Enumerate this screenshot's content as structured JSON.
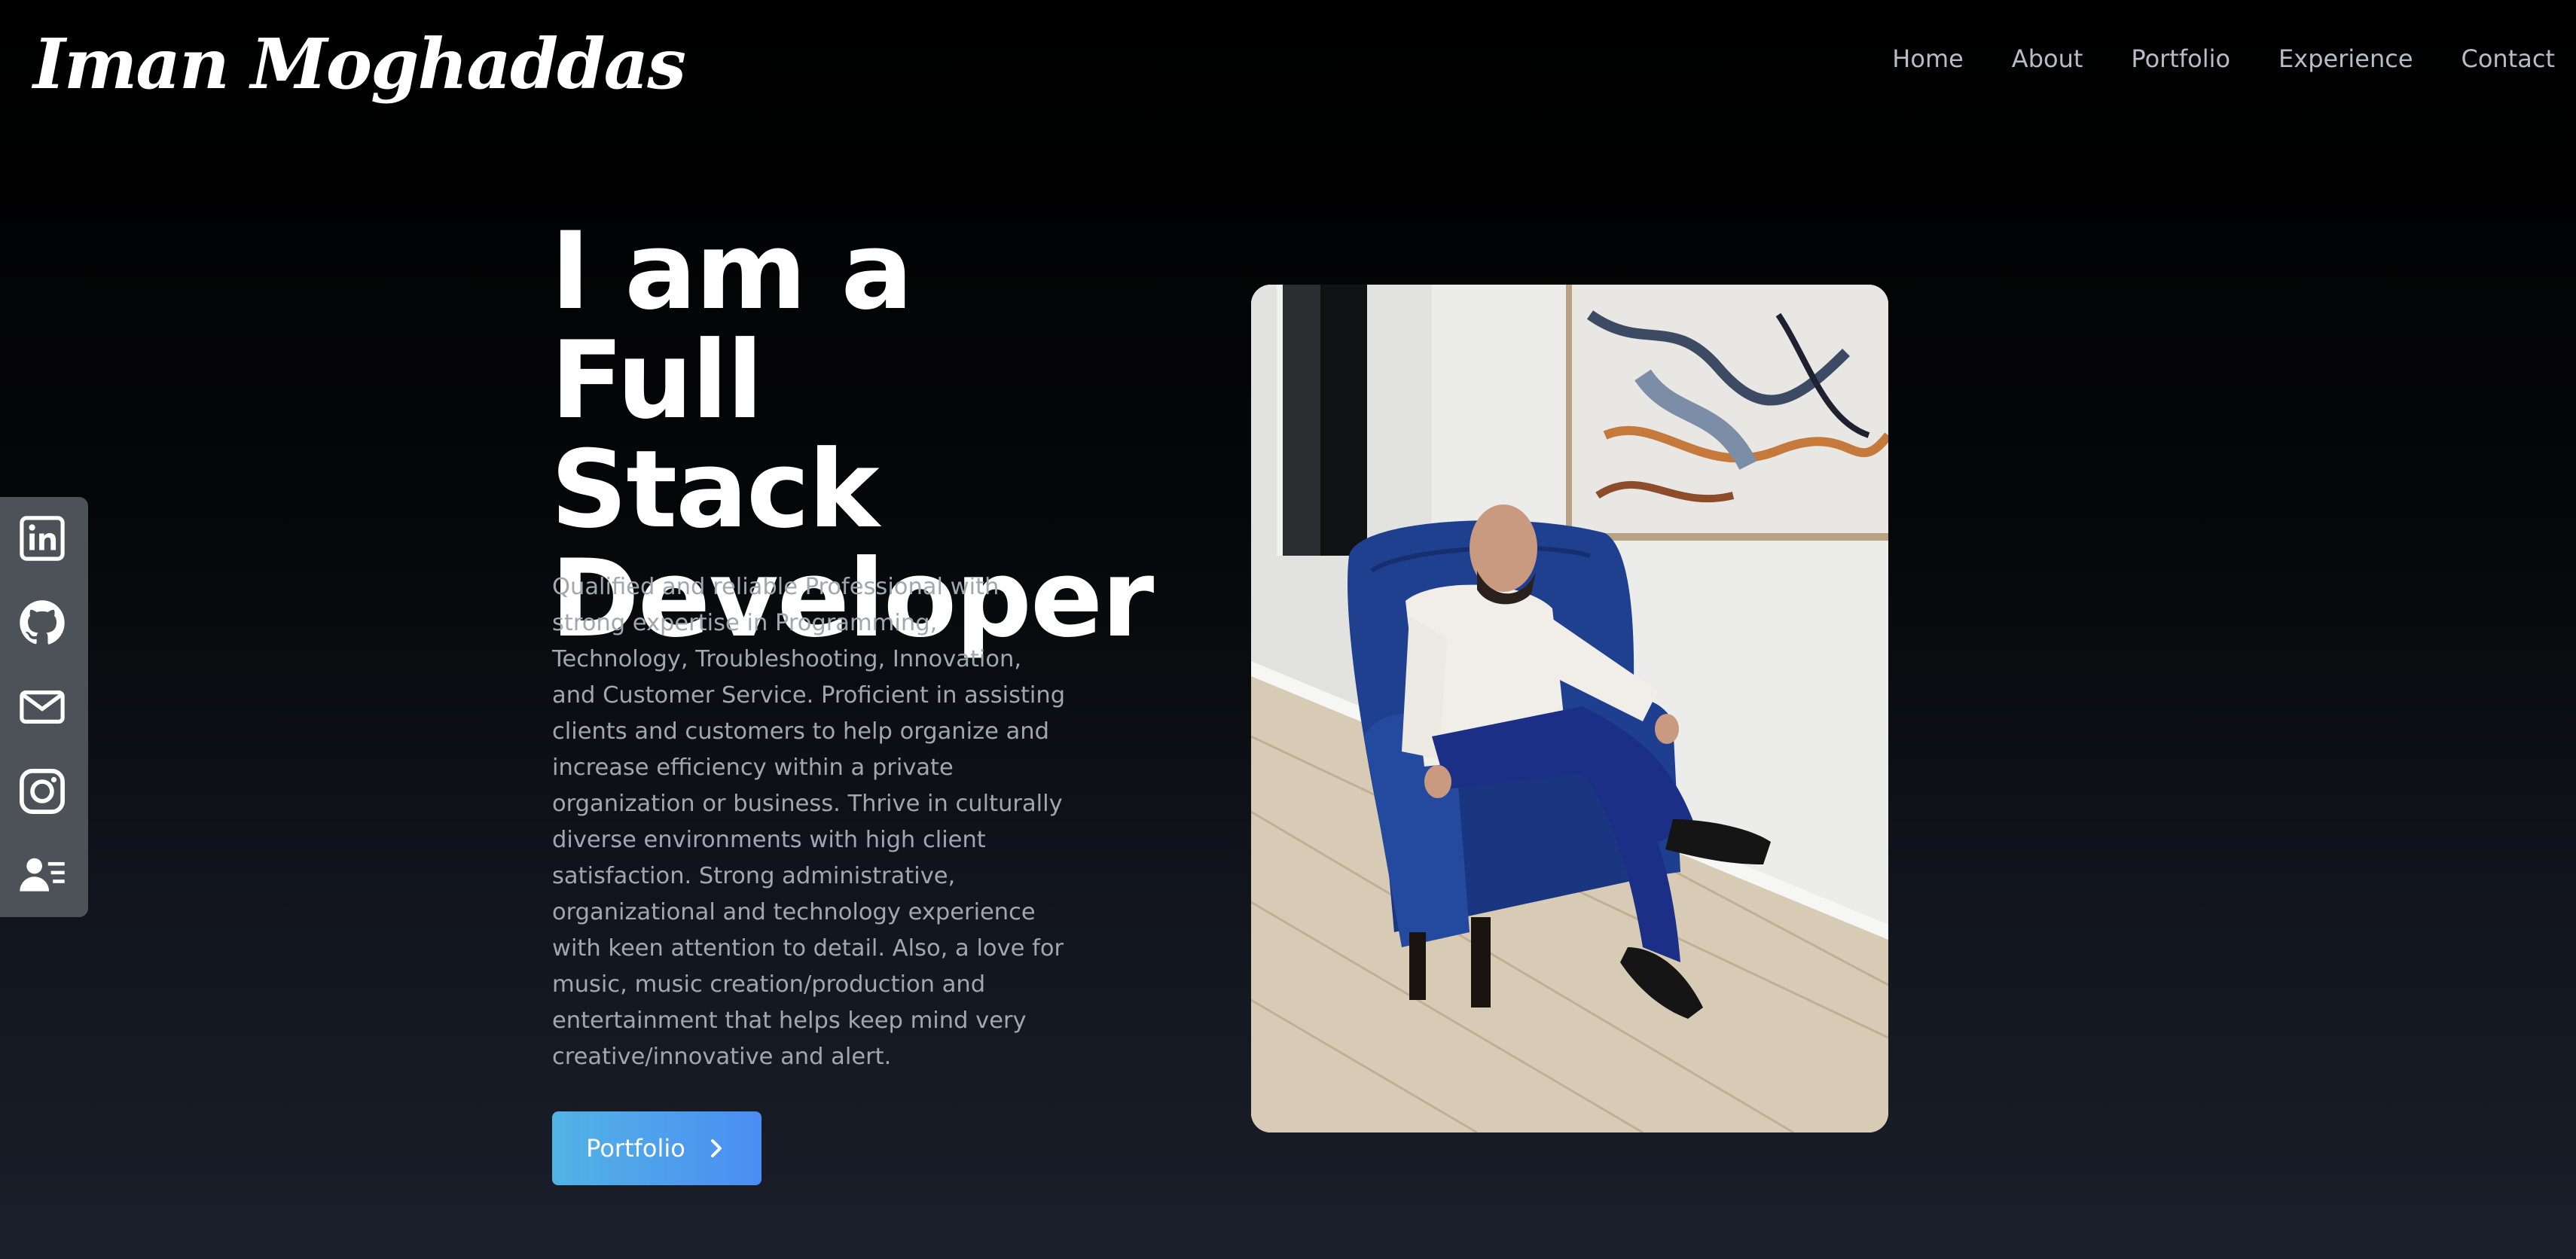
{
  "header": {
    "logo": "Iman Moghaddas",
    "nav": [
      {
        "label": "Home"
      },
      {
        "label": "About"
      },
      {
        "label": "Portfolio"
      },
      {
        "label": "Experience"
      },
      {
        "label": "Contact"
      }
    ]
  },
  "social": {
    "icons": [
      "linkedin-icon",
      "github-icon",
      "mail-icon",
      "instagram-icon",
      "resume-icon"
    ],
    "background": "#4d5158"
  },
  "hero": {
    "title": "I am a Full Stack Developer",
    "description": "Qualified and reliable Professional with strong expertise in Programming, Technology, Troubleshooting, Innovation, and Customer Service. Proficient in assisting clients and customers to help organize and increase efficiency within a private organization or business. Thrive in culturally diverse environments with high client satisfaction. Strong administrative, organizational and technology experience with keen attention to detail. Also, a love for music, music creation/production and entertainment that helps keep mind very creative/innovative and alert.",
    "cta_label": "Portfolio",
    "cta_icon": "chevron-right-icon"
  },
  "colors": {
    "accent_start": "#52b3e4",
    "accent_end": "#4b8df3",
    "nav_text": "#b8bcc6",
    "description_text": "#a2a6ae"
  }
}
